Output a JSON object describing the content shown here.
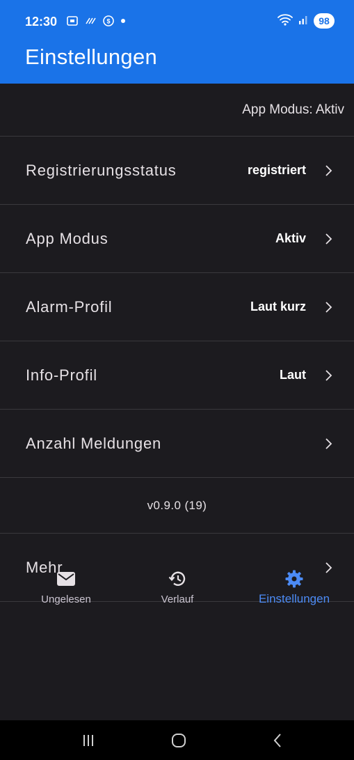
{
  "status_bar": {
    "time": "12:30",
    "battery": "98",
    "icons_left": [
      "screenshot-icon",
      "nfc-icon",
      "data-saver-icon",
      "notification-dot-icon"
    ],
    "icons_right": [
      "wifi-icon",
      "signal-icon"
    ]
  },
  "app_bar": {
    "title": "Einstellungen",
    "color": "#1a73e8"
  },
  "mode_banner": "App Modus: Aktiv",
  "settings": [
    {
      "label": "Registrierungsstatus",
      "value": "registriert"
    },
    {
      "label": "App Modus",
      "value": "Aktiv"
    },
    {
      "label": "Alarm-Profil",
      "value": "Laut kurz"
    },
    {
      "label": "Info-Profil",
      "value": "Laut"
    },
    {
      "label": "Anzahl Meldungen",
      "value": ""
    }
  ],
  "version": "v0.9.0 (19)",
  "more": {
    "label": "Mehr"
  },
  "bottom_nav": {
    "items": [
      {
        "label": "Ungelesen",
        "icon": "mail-icon",
        "active": false
      },
      {
        "label": "Verlauf",
        "icon": "history-icon",
        "active": false
      },
      {
        "label": "Einstellungen",
        "icon": "gear-icon",
        "active": true
      }
    ],
    "active_color": "#4c8bf5"
  },
  "system_nav": [
    "recents-button",
    "home-button",
    "back-button"
  ]
}
